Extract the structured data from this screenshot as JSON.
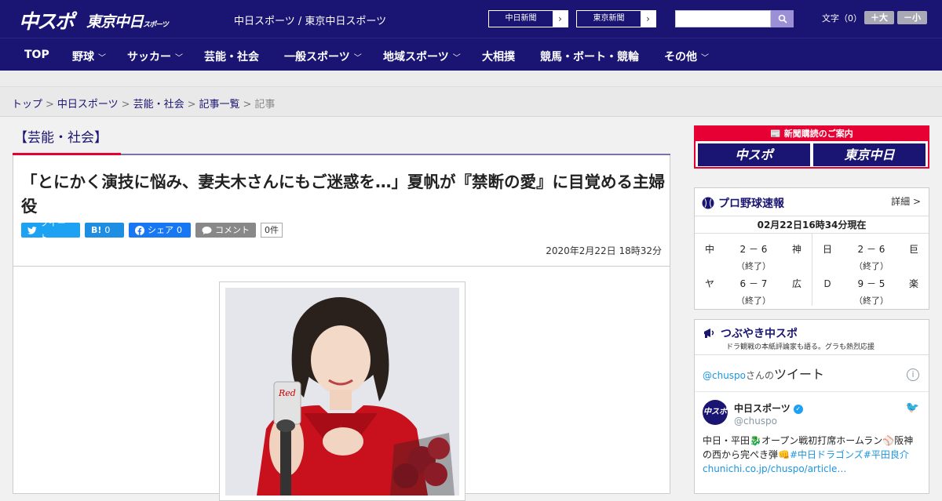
{
  "header": {
    "logo_main": "中スポ",
    "logo_tokyo": "東京中日",
    "logo_tokyo_small": "スポーツ",
    "site_names": "中日スポーツ / 東京中日スポーツ",
    "ext_links": [
      "中日新聞",
      "東京新聞"
    ],
    "search_placeholder": "",
    "font_size_label": "文字（0）",
    "font_plus": "＋大",
    "font_minus": "－小"
  },
  "nav": {
    "items": [
      {
        "label": "TOP",
        "has_menu": false
      },
      {
        "label": "野球",
        "has_menu": true
      },
      {
        "label": "サッカー",
        "has_menu": true
      },
      {
        "label": "芸能・社会",
        "has_menu": false
      },
      {
        "label": "一般スポーツ",
        "has_menu": true
      },
      {
        "label": "地域スポーツ",
        "has_menu": true
      },
      {
        "label": "大相撲",
        "has_menu": false
      },
      {
        "label": "競馬・ボート・競輪",
        "has_menu": false
      },
      {
        "label": "その他",
        "has_menu": true
      }
    ]
  },
  "breadcrumb": {
    "items": [
      "トップ",
      "中日スポーツ",
      "芸能・社会",
      "記事一覧",
      "記事"
    ]
  },
  "article": {
    "category": "【芸能・社会】",
    "title": "「とにかく演技に悩み、妻夫木さんにもご迷惑を…」夏帆が『禁断の愛』に目覚める主婦役",
    "share": {
      "tweet": "ツイート",
      "hatena": "B!",
      "hatena_count": "0",
      "facebook": "シェア",
      "facebook_count": "0",
      "comment": "コメント",
      "comment_count": "0件"
    },
    "date": "2020年2月22日 18時32分",
    "photo_caption_mic": "Red"
  },
  "sidebar": {
    "subscribe": {
      "heading": "新聞購読のご案内",
      "logos": [
        "中スポ",
        "東京中日"
      ]
    },
    "baseball": {
      "title": "プロ野球速報",
      "detail": "詳細 >",
      "time": "02月22日16時34分現在",
      "games": [
        {
          "home": "中",
          "score": "2 － 6",
          "away": "神",
          "status": "（終了）"
        },
        {
          "home": "日",
          "score": "2 － 6",
          "away": "巨",
          "status": "（終了）"
        },
        {
          "home": "ヤ",
          "score": "6 － 7",
          "away": "広",
          "status": "（終了）"
        },
        {
          "home": "Ｄ",
          "score": "9 － 5",
          "away": "楽",
          "status": "（終了）"
        }
      ]
    },
    "tweets": {
      "title": "つぶやき中スポ",
      "subtitle": "ドラ観戦の本紙評論家も語る。グラも熱烈応援",
      "handle": "@chuspo",
      "handle_suffix": "さんの",
      "heading": "ツイート",
      "account_name": "中日スポーツ",
      "account_user": "@chuspo",
      "avatar_text": "中スポ",
      "text_1": "中日・平田🐉オープン戦初打席ホームラン⚾阪神の西から完ぺき弾👊",
      "tag_1": "#中日ドラゴンズ",
      "tag_2": "#平田良介",
      "link": "chunichi.co.jp/chuspo/article…"
    }
  }
}
